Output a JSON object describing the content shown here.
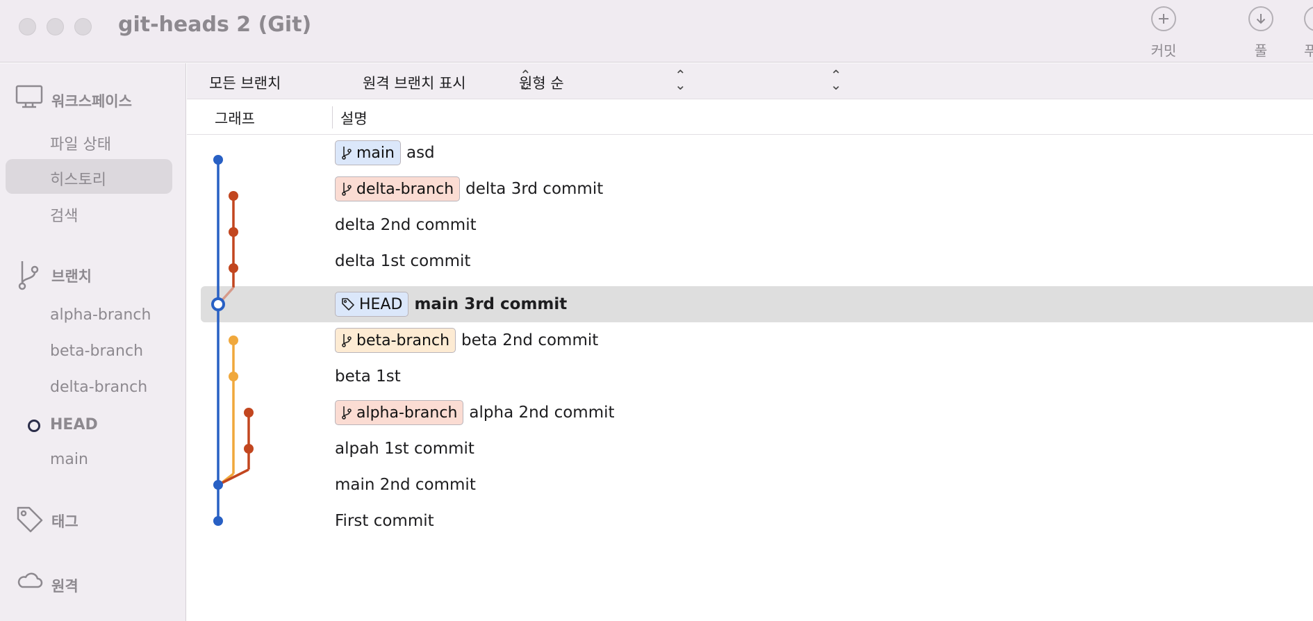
{
  "window": {
    "title": "git-heads 2 (Git)"
  },
  "toolbar": {
    "commit_label": "커밋",
    "pull_label": "풀",
    "push_label": "푸"
  },
  "sidebar": {
    "workspace_header": "워크스페이스",
    "workspace_items": [
      {
        "label": "파일 상태",
        "selected": false
      },
      {
        "label": "히스토리",
        "selected": true
      },
      {
        "label": "검색",
        "selected": false
      }
    ],
    "branches_header": "브랜치",
    "branches": [
      {
        "label": "alpha-branch",
        "current": false
      },
      {
        "label": "beta-branch",
        "current": false
      },
      {
        "label": "delta-branch",
        "current": false
      },
      {
        "label": "HEAD",
        "current": true
      },
      {
        "label": "main",
        "current": false
      }
    ],
    "tags_header": "태그",
    "remotes_header": "원격"
  },
  "filters": {
    "branches": "모든 브랜치",
    "remote_branches": "원격 브랜치 표시",
    "order": "원형 순"
  },
  "columns": {
    "graph": "그래프",
    "description": "설명"
  },
  "commits": [
    {
      "ref": "main",
      "ref_kind": "branch",
      "ref_color": "#dbe7fa",
      "message": "asd",
      "lane_color": "#2860c4"
    },
    {
      "ref": "delta-branch",
      "ref_kind": "branch",
      "ref_color": "#fbdcd3",
      "message": "delta 3rd commit",
      "lane_color": "#c2461f"
    },
    {
      "ref": "",
      "message": "delta 2nd commit",
      "lane_color": "#c2461f"
    },
    {
      "ref": "",
      "message": "delta 1st commit",
      "lane_color": "#c2461f"
    },
    {
      "ref": "HEAD",
      "ref_kind": "tag",
      "ref_color": "#dbe7fa",
      "message": "main 3rd commit",
      "selected": true,
      "lane_color": "#2860c4"
    },
    {
      "ref": "beta-branch",
      "ref_kind": "branch",
      "ref_color": "#fdebd3",
      "message": "beta 2nd commit",
      "lane_color": "#f0a83c"
    },
    {
      "ref": "",
      "message": "beta 1st",
      "lane_color": "#f0a83c"
    },
    {
      "ref": "alpha-branch",
      "ref_kind": "branch",
      "ref_color": "#fbdcd3",
      "message": "alpha 2nd commit",
      "lane_color": "#c2461f"
    },
    {
      "ref": "",
      "message": "alpah 1st commit",
      "lane_color": "#c2461f"
    },
    {
      "ref": "",
      "message": "main 2nd commit",
      "lane_color": "#2860c4"
    },
    {
      "ref": "",
      "message": "First commit",
      "lane_color": "#2860c4"
    }
  ]
}
